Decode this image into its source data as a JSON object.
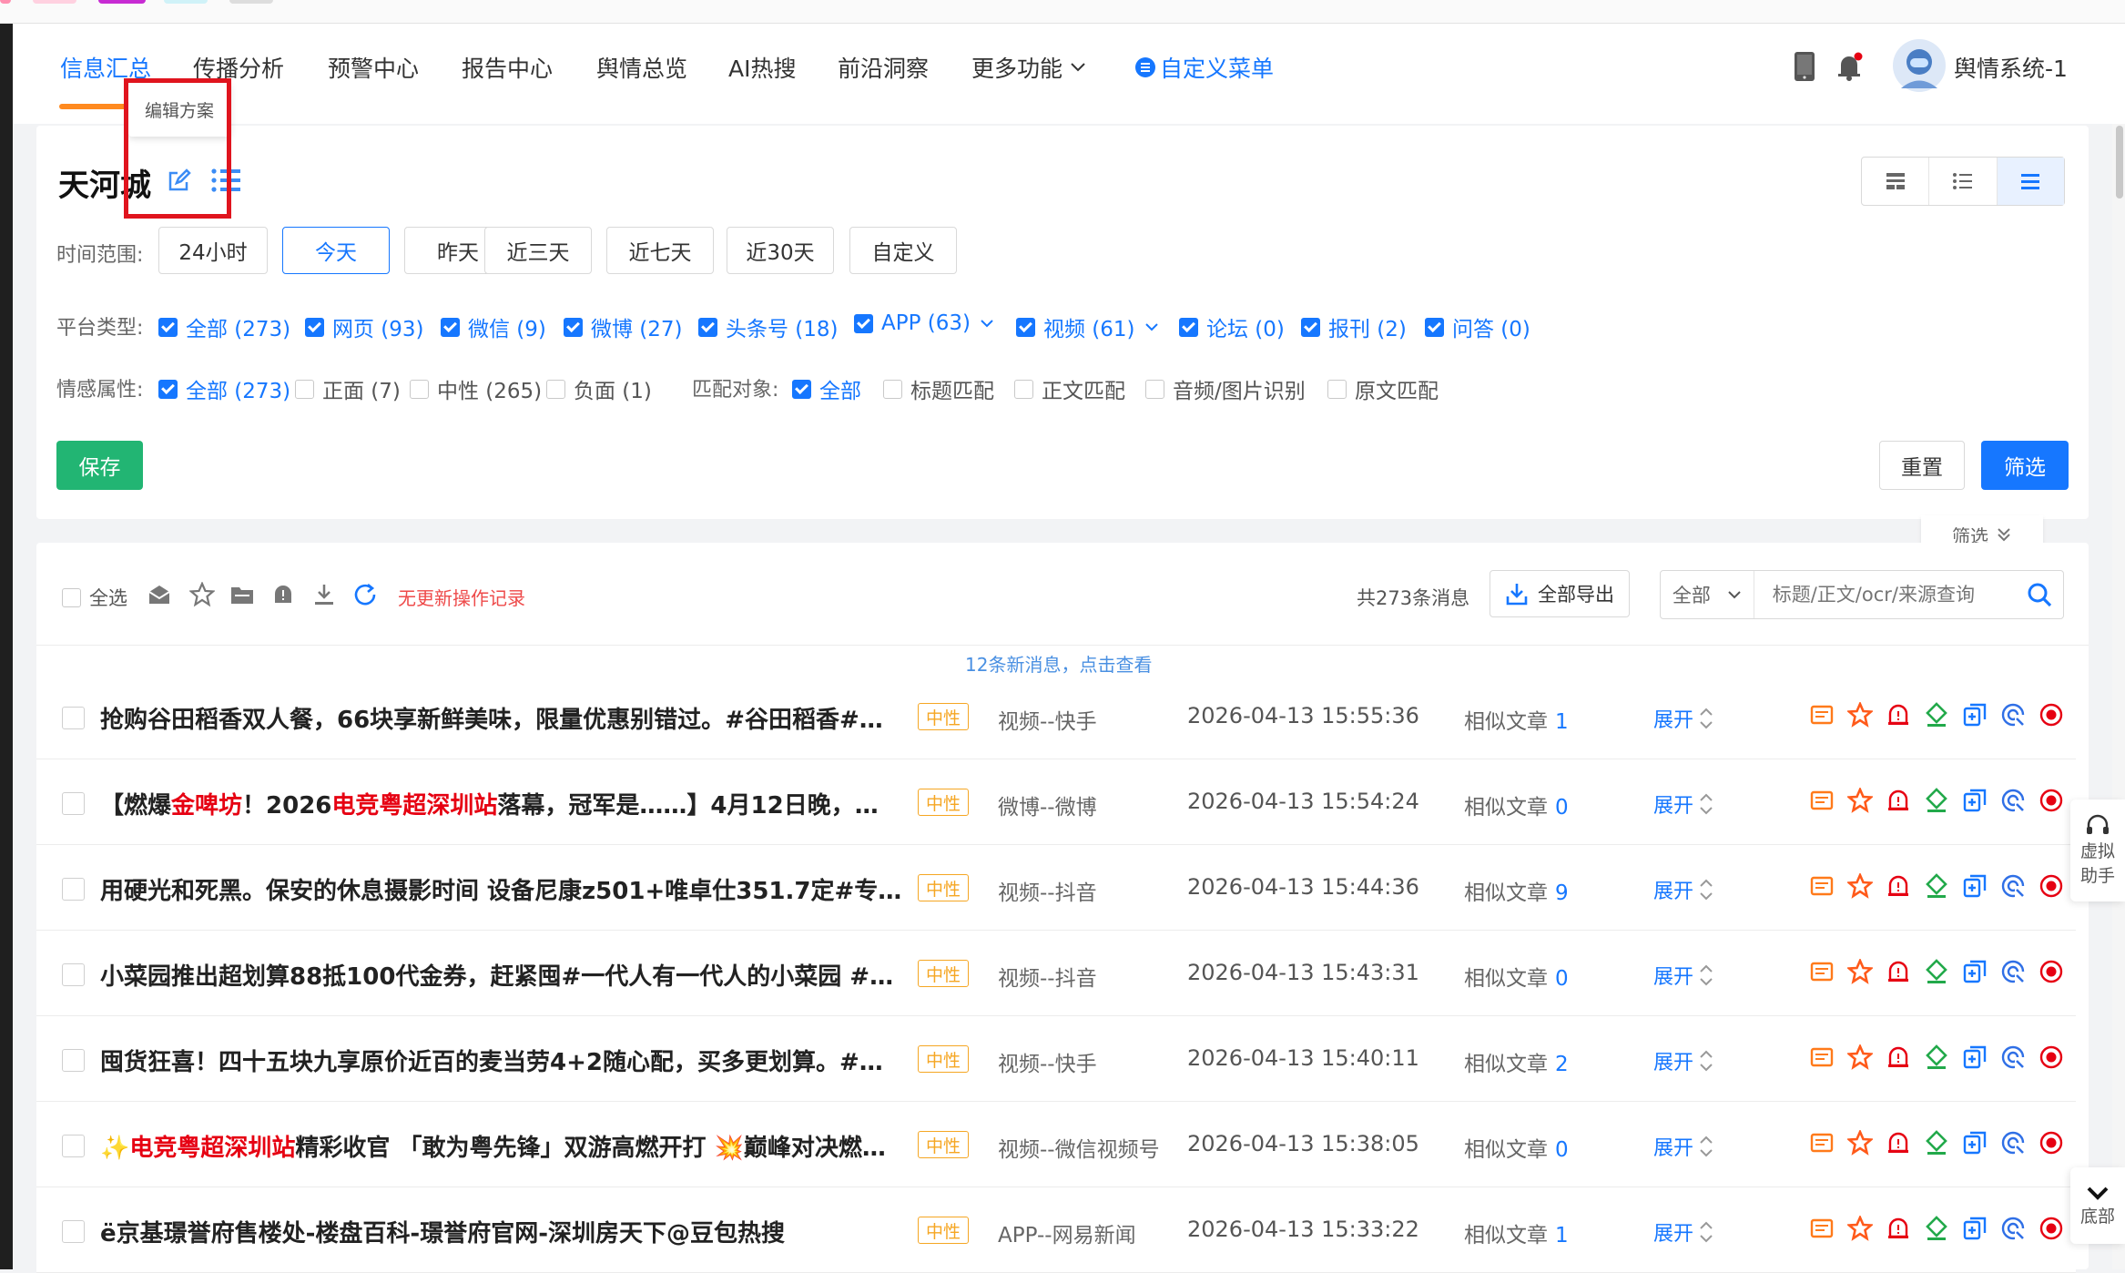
{
  "nav": {
    "items": [
      "信息汇总",
      "传播分析",
      "预警中心",
      "报告中心",
      "舆情总览",
      "AI热搜",
      "前沿洞察",
      "更多功能"
    ],
    "custom_menu": "自定义菜单",
    "user_name": "舆情系统-1"
  },
  "scheme": {
    "title": "天河城",
    "tooltip": "编辑方案"
  },
  "time_range": {
    "label": "时间范围:",
    "options": [
      "24小时",
      "今天",
      "昨天",
      "近三天",
      "近七天",
      "近30天",
      "自定义"
    ],
    "selected": "今天"
  },
  "platform": {
    "label": "平台类型:",
    "options": [
      "全部 (273)",
      "网页 (93)",
      "微信 (9)",
      "微博 (27)",
      "头条号 (18)",
      "APP (63)",
      "视频 (61)",
      "论坛 (0)",
      "报刊 (2)",
      "问答 (0)"
    ]
  },
  "sentiment": {
    "label": "情感属性:",
    "options": [
      "全部 (273)",
      "正面 (7)",
      "中性 (265)",
      "负面 (1)"
    ]
  },
  "match": {
    "label": "匹配对象:",
    "options": [
      "全部",
      "标题匹配",
      "正文匹配",
      "音频/图片识别",
      "原文匹配"
    ]
  },
  "buttons": {
    "save": "保存",
    "reset": "重置",
    "filter": "筛选",
    "filter_toggle": "筛选"
  },
  "toolbar": {
    "select_all": "全选",
    "no_record": "无更新操作记录",
    "total": "共273条消息",
    "export_all": "全部导出",
    "scope_select": "全部",
    "search_placeholder": "标题/正文/ocr/来源查询"
  },
  "new_messages": "12条新消息，点击查看",
  "articles": [
    {
      "title_parts": [
        {
          "t": "抢购谷田稻香双人餐，66块享新鲜美味，限量优惠别错过。#谷田稻香#…",
          "h": false
        }
      ],
      "tag": "中性",
      "source": "视频--快手",
      "time": "2026-04-13 15:55:36",
      "similar_label": "相似文章",
      "similar": "1",
      "expand": "展开"
    },
    {
      "title_parts": [
        {
          "t": "【燃爆",
          "h": false
        },
        {
          "t": "金啤坊",
          "h": true
        },
        {
          "t": "！2026",
          "h": false
        },
        {
          "t": "电竞粤超深圳站",
          "h": true
        },
        {
          "t": "落幕，冠军是……】4月12日晚，…",
          "h": false
        }
      ],
      "tag": "中性",
      "source": "微博--微博",
      "time": "2026-04-13 15:54:24",
      "similar_label": "相似文章",
      "similar": "0",
      "expand": "展开"
    },
    {
      "title_parts": [
        {
          "t": "用硬光和死黑。保安的休息摄影时间 设备尼康z501+唯卓仕351.7定#专…",
          "h": false
        }
      ],
      "tag": "中性",
      "source": "视频--抖音",
      "time": "2026-04-13 15:44:36",
      "similar_label": "相似文章",
      "similar": "9",
      "expand": "展开"
    },
    {
      "title_parts": [
        {
          "t": "小菜园推出超划算88抵100代金券，赶紧囤#一代人有一代人的小菜园 #…",
          "h": false
        }
      ],
      "tag": "中性",
      "source": "视频--抖音",
      "time": "2026-04-13 15:43:31",
      "similar_label": "相似文章",
      "similar": "0",
      "expand": "展开"
    },
    {
      "title_parts": [
        {
          "t": "囤货狂喜！四十五块九享原价近百的麦当劳4+2随心配，买多更划算。#…",
          "h": false
        }
      ],
      "tag": "中性",
      "source": "视频--快手",
      "time": "2026-04-13 15:40:11",
      "similar_label": "相似文章",
      "similar": "2",
      "expand": "展开"
    },
    {
      "title_parts": [
        {
          "t": "✨",
          "h": false
        },
        {
          "t": "电竞粤超深圳站",
          "h": true
        },
        {
          "t": "精彩收官 「敢为粤先锋」双游高燃开打 💥巅峰对决燃…",
          "h": false
        }
      ],
      "tag": "中性",
      "source": "视频--微信视频号",
      "time": "2026-04-13 15:38:05",
      "similar_label": "相似文章",
      "similar": "0",
      "expand": "展开"
    },
    {
      "title_parts": [
        {
          "t": "ё京基璟誉府售楼处-楼盘百科-璟誉府官网-深圳房天下@豆包热搜",
          "h": false
        }
      ],
      "tag": "中性",
      "source": "APP--网易新闻",
      "time": "2026-04-13 15:33:22",
      "similar_label": "相似文章",
      "similar": "1",
      "expand": "展开"
    }
  ],
  "side": {
    "assistant": [
      "虚拟",
      "助手"
    ],
    "bottom": "底部"
  },
  "colors": {
    "accent": "#1677ff",
    "highlight": "#e60012",
    "save": "#22b573",
    "orange": "#ff8a1f",
    "red_frame": "#e0141e"
  }
}
